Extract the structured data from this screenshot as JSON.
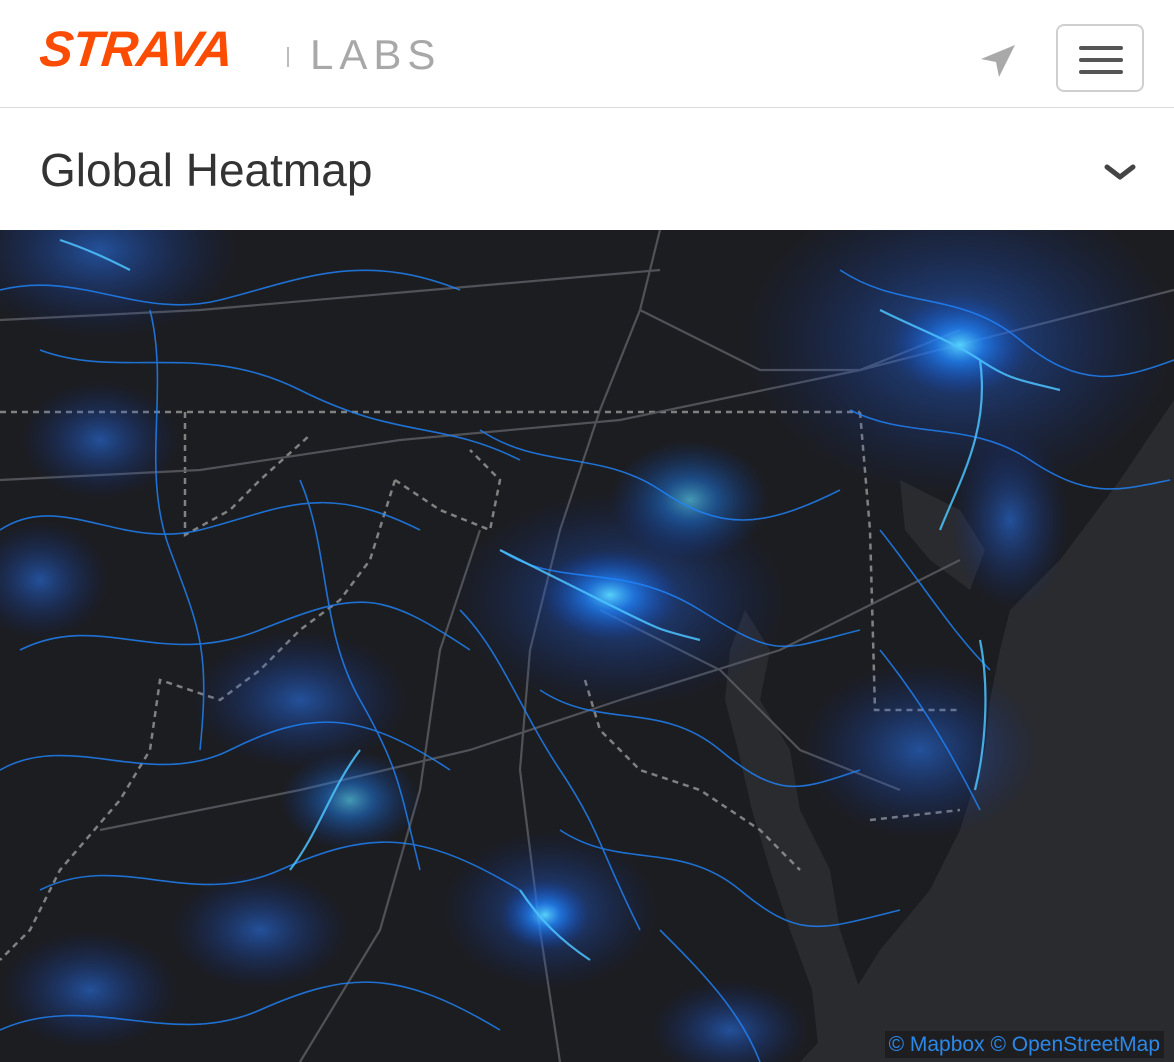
{
  "header": {
    "brand": "STRAVA",
    "section": "LABS",
    "brand_color": "#fc4c02",
    "locate_icon": "location-arrow-icon",
    "menu_icon": "hamburger-menu-icon"
  },
  "subheader": {
    "title": "Global Heatmap",
    "toggle_icon": "chevron-down-icon"
  },
  "map": {
    "background_color": "#1c1d20",
    "heat_color": "#1e7cff",
    "heat_hot_color": "#55d6ff",
    "attribution": {
      "mapbox": "© Mapbox",
      "osm": "© OpenStreetMap"
    }
  }
}
